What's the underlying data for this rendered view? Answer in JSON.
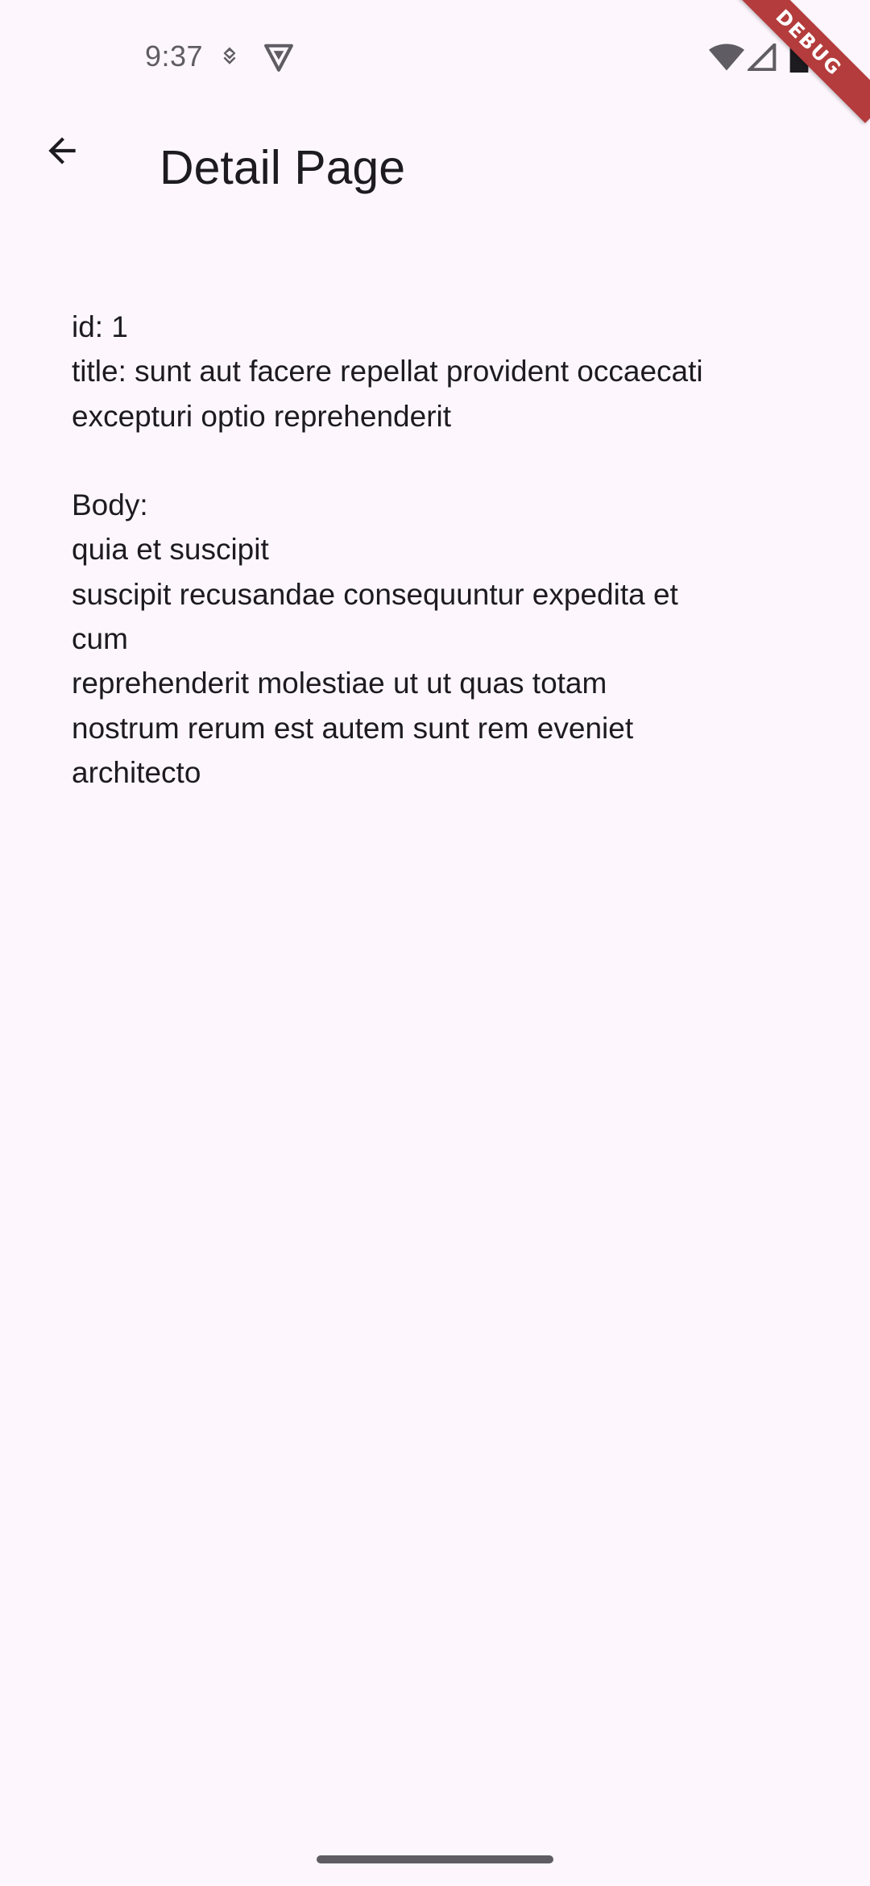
{
  "status_bar": {
    "time": "9:37",
    "icons": [
      "download-notification-icon",
      "vpn-shield-icon",
      "wifi-icon",
      "cell-signal-icon",
      "battery-icon"
    ]
  },
  "debug_banner": {
    "label": "DEBUG",
    "color": "#b43c3c"
  },
  "app_bar": {
    "back_icon": "arrow-back-icon",
    "title": "Detail Page"
  },
  "post": {
    "id_line": "id: 1",
    "title_line_1": "title: sunt aut facere repellat provident occaecati",
    "title_line_2": "excepturi optio reprehenderit",
    "body_label": "Body:",
    "body_lines": [
      "quia et suscipit",
      "suscipit recusandae consequuntur expedita et",
      "cum",
      "reprehenderit molestiae ut ut quas totam",
      "nostrum rerum est autem sunt rem eveniet",
      "architecto"
    ]
  },
  "colors": {
    "background": "#fdf7fd",
    "text": "#1d1b20",
    "status_text": "#5f5c63"
  }
}
